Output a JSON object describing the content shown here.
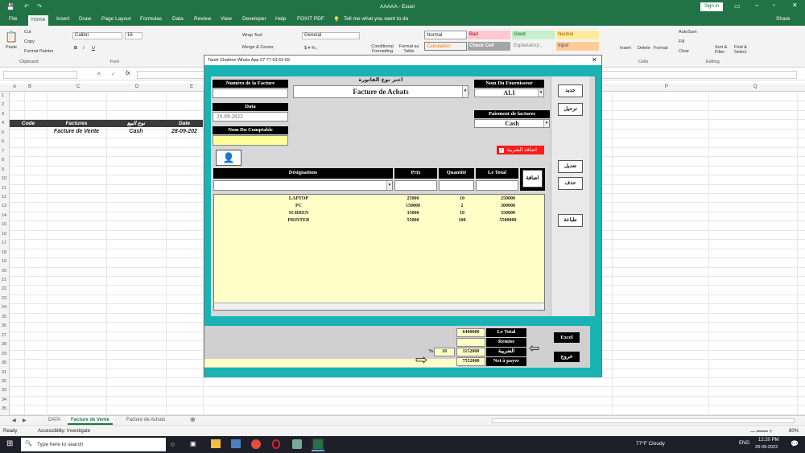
{
  "app": {
    "window_title": "AAAAA - Excel",
    "signin": "Sign in",
    "share": "Share"
  },
  "tabs": [
    "File",
    "Home",
    "Insert",
    "Draw",
    "Page Layout",
    "Formulas",
    "Data",
    "Review",
    "View",
    "Developer",
    "Help",
    "FOXIT PDF"
  ],
  "tell_me": "Tell me what you want to do",
  "ribbon": {
    "clipboard": {
      "paste": "Paste",
      "cut": "Cut",
      "copy": "Copy",
      "format_painter": "Format Painter",
      "group": "Clipboard"
    },
    "font": {
      "name": "Calibri",
      "size": "16",
      "group": "Font"
    },
    "alignment": {
      "wrap": "Wrap Text",
      "merge": "Merge & Center"
    },
    "number": {
      "format": "General"
    },
    "styles": {
      "conditional": "Conditional Formatting",
      "format_as": "Format as Table",
      "normal": "Normal",
      "bad": "Bad",
      "good": "Good",
      "neutral": "Neutral",
      "calculation": "Calculation",
      "check_cell": "Check Cell",
      "explanatory": "Explanatory...",
      "input": "Input"
    },
    "cells": {
      "insert": "Insert",
      "delete": "Delete",
      "format": "Format",
      "group": "Cells"
    },
    "editing": {
      "autosum": "AutoSum",
      "fill": "Fill",
      "clear": "Clear",
      "sort": "Sort & Filter",
      "find": "Find & Select",
      "group": "Editing"
    }
  },
  "formula": {
    "fx": "fx"
  },
  "columns": [
    "A",
    "B",
    "C",
    "D",
    "E",
    "P",
    "Q"
  ],
  "rows": [
    "1",
    "2",
    "3",
    "4",
    "5",
    "6",
    "7",
    "8",
    "9",
    "10",
    "11",
    "12",
    "13",
    "14",
    "15",
    "16",
    "17",
    "18",
    "19",
    "20",
    "21",
    "22",
    "23",
    "24",
    "25",
    "26",
    "27",
    "28",
    "29",
    "30",
    "31",
    "32",
    "33",
    "34",
    "35"
  ],
  "sheet": {
    "headers": [
      "Code",
      "Factures",
      "نوع البيع",
      "Date"
    ],
    "row": [
      "",
      "Facture de Vente",
      "Cash",
      "28-09-202"
    ]
  },
  "sheet_tabs": [
    "DATA",
    "Facture de Vente",
    "Facture de Achats"
  ],
  "status": {
    "ready": "Ready",
    "accessibility": "Accessibility: Investigate",
    "zoom": "80%"
  },
  "taskbar": {
    "search": "Type here to search",
    "weather": "77°F Cloudy",
    "lang": "ENG",
    "time": "12:20 PM",
    "date": "29-09-2022"
  },
  "form": {
    "title": "Tarek Chahine Whats App 07 77 63 63 69",
    "numero_label": "Numéro de la Facture",
    "type_label": "اختر نوع الفاتورة",
    "type_value": "Facture de Achats",
    "fournisseur_label": "Nom Du Fournisseur",
    "fournisseur_value": "ALI",
    "data_label": "Data",
    "data_value": "29-09-2022",
    "comptable_label": "Nom Du Comptable",
    "paiement_label": "Paiement de factures",
    "paiement_value": "Cash",
    "tax_check": "اضافة الضريبة",
    "col_designations": "Désignations",
    "col_prix": "Prix",
    "col_quantite": "Quantité",
    "col_total": "Le Total",
    "add_btn": "اضافة",
    "items": [
      {
        "d": "LAPTOP",
        "p": "25000",
        "q": "10",
        "t": "250000"
      },
      {
        "d": "PC",
        "p": "150000",
        "q": "2",
        "t": "300000"
      },
      {
        "d": "SCRREN",
        "p": "35000",
        "q": "10",
        "t": "350000"
      },
      {
        "d": "PRINTER",
        "p": "55000",
        "q": "100",
        "t": "5500000"
      }
    ],
    "btn_new": "جديد",
    "btn_post": "ترحيل",
    "btn_edit": "تعديل",
    "btn_delete": "حذف",
    "btn_print": "طباعة",
    "total_label": "Le Total",
    "total_value": "6400000",
    "remise_label": "Remise",
    "tax_label": "الضريبة",
    "tax_pct_sign": "%",
    "tax_pct": "18",
    "tax_value": "1152000",
    "net_label": "Net à payer",
    "net_value": "7552000",
    "btn_excel": "Excel",
    "btn_exit": "خروج"
  }
}
